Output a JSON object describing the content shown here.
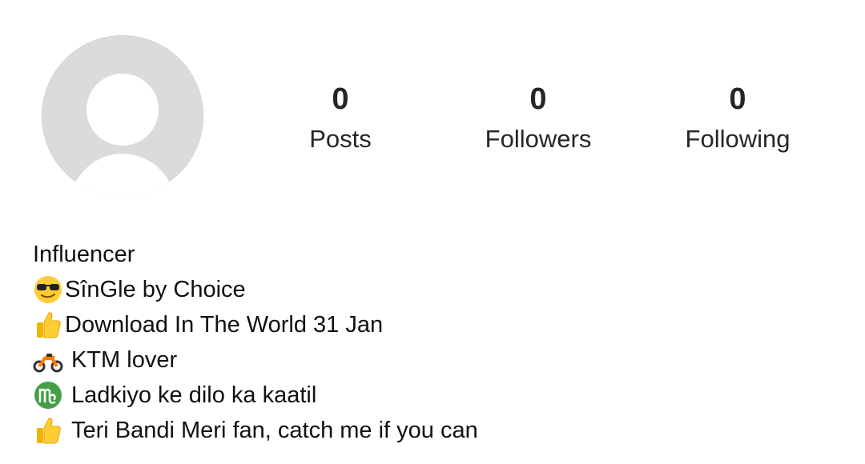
{
  "profile": {
    "stats": [
      {
        "count": "0",
        "label": "Posts"
      },
      {
        "count": "0",
        "label": "Followers"
      },
      {
        "count": "0",
        "label": "Following"
      }
    ],
    "bio": {
      "category": "Influencer",
      "lines": [
        {
          "icon": "sunglasses-face-icon",
          "text": "SînGle by Choice"
        },
        {
          "icon": "thumbs-up-icon",
          "text": "Download In The World 31 Jan"
        },
        {
          "icon": "motorcycle-icon",
          "text": "KTM lover"
        },
        {
          "icon": "virgo-icon",
          "text": "Ladkiyo ke dilo ka kaatil"
        },
        {
          "icon": "thumbs-up-icon",
          "text": "Teri Bandi Meri fan, catch me if you can"
        }
      ]
    }
  },
  "colors": {
    "avatar_bg": "#dbdbdb",
    "avatar_figure": "#ffffff",
    "text": "#262626",
    "emoji_yellow": "#ffcc33",
    "virgo_green": "#43a047"
  }
}
